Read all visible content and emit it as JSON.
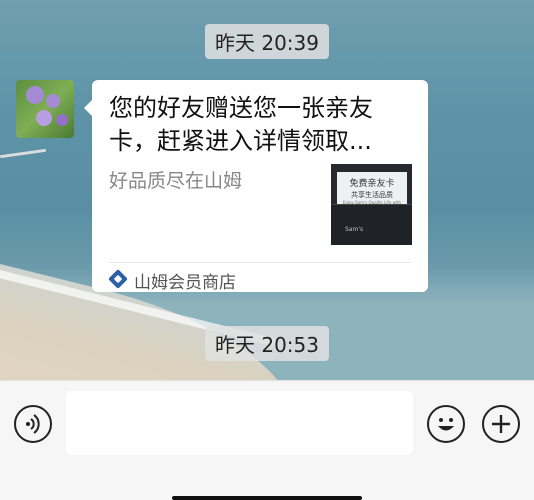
{
  "chat": {
    "timestamps": [
      "昨天 20:39",
      "昨天 20:53"
    ],
    "message": {
      "title": "您的好友赠送您一张亲友卡，赶紧进入详情领取...",
      "description": "好品质尽在山姆",
      "thumbnail": {
        "line1": "免费亲友卡",
        "line2": "共享生活品质",
        "line3": "Enjoy Sam's Quality Life with Family & Friends",
        "brand": "Sam's"
      },
      "source": "山姆会员商店"
    }
  },
  "input_bar": {
    "message_value": "",
    "icons": [
      "voice-icon",
      "emoji-icon",
      "plus-icon"
    ]
  },
  "colors": {
    "bubble": "#ffffff",
    "source_brand": "#2d5fa6",
    "input_bar": "#f6f6f6"
  }
}
